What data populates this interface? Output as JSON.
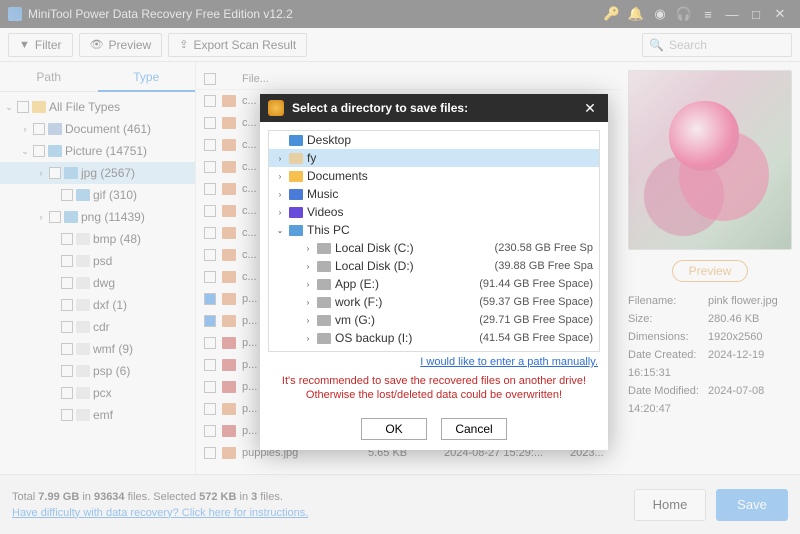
{
  "titlebar": {
    "title": "MiniTool Power Data Recovery Free Edition v12.2"
  },
  "toolbar": {
    "filter": "Filter",
    "preview": "Preview",
    "export": "Export Scan Result",
    "search_placeholder": "Search"
  },
  "tabs": {
    "path": "Path",
    "type": "Type"
  },
  "tree": {
    "all": "All File Types",
    "document": "Document (461)",
    "picture": "Picture (14751)",
    "jpg": "jpg (2567)",
    "gif": "gif (310)",
    "png": "png (11439)",
    "bmp": "bmp (48)",
    "psd": "psd",
    "dwg": "dwg",
    "dxf": "dxf (1)",
    "cdr": "cdr",
    "wmf": "wmf (9)",
    "psp": "psp (6)",
    "pcx": "pcx",
    "emf": "emf"
  },
  "filelist": {
    "header": "File...",
    "rows": [
      {
        "name": "c...",
        "checked": false,
        "bad": false
      },
      {
        "name": "c...",
        "checked": false,
        "bad": false
      },
      {
        "name": "c...",
        "checked": false,
        "bad": false
      },
      {
        "name": "c...",
        "checked": false,
        "bad": false
      },
      {
        "name": "c...",
        "checked": false,
        "bad": false
      },
      {
        "name": "c...",
        "checked": false,
        "bad": false
      },
      {
        "name": "c...",
        "checked": false,
        "bad": false
      },
      {
        "name": "c...",
        "checked": false,
        "bad": false
      },
      {
        "name": "c...",
        "checked": false,
        "bad": false
      },
      {
        "name": "p...",
        "checked": true,
        "bad": false
      },
      {
        "name": "p...",
        "checked": true,
        "bad": false
      },
      {
        "name": "p...",
        "checked": false,
        "bad": true
      },
      {
        "name": "p...",
        "checked": false,
        "bad": true
      },
      {
        "name": "p...",
        "checked": false,
        "bad": true
      },
      {
        "name": "p...",
        "checked": false,
        "bad": false
      },
      {
        "name": "p...",
        "checked": false,
        "bad": true
      }
    ],
    "last": {
      "name": "puppies.jpg",
      "size": "5.65 KB",
      "date": "2024-08-27 15:29:...",
      "year": "2023..."
    }
  },
  "preview": {
    "button": "Preview",
    "fields": {
      "filename_k": "Filename:",
      "filename_v": "pink flower.jpg",
      "size_k": "Size:",
      "size_v": "280.46 KB",
      "dim_k": "Dimensions:",
      "dim_v": "1920x2560",
      "created_k": "Date Created:",
      "created_v": "2024-12-19 16:15:31",
      "modified_k": "Date Modified:",
      "modified_v": "2024-07-08 14:20:47"
    }
  },
  "bottom": {
    "line1_a": "Total ",
    "line1_b": "7.99 GB",
    "line1_c": " in ",
    "line1_d": "93634",
    "line1_e": " files.   Selected ",
    "line1_f": "572 KB",
    "line1_g": " in ",
    "line1_h": "3",
    "line1_i": " files.",
    "help": "Have difficulty with data recovery? Click here for instructions.",
    "home": "Home",
    "save": "Save"
  },
  "modal": {
    "title": "Select a directory to save files:",
    "items": {
      "desktop": "Desktop",
      "fy": "fy",
      "documents": "Documents",
      "music": "Music",
      "videos": "Videos",
      "thispc": "This PC"
    },
    "drives": [
      {
        "name": "Local Disk (C:)",
        "free": "(230.58 GB Free Sp"
      },
      {
        "name": "Local Disk (D:)",
        "free": "(39.88 GB Free Spa"
      },
      {
        "name": "App (E:)",
        "free": "(91.44 GB Free Space)"
      },
      {
        "name": "work (F:)",
        "free": "(59.37 GB Free Space)"
      },
      {
        "name": "vm (G:)",
        "free": "(29.71 GB Free Space)"
      },
      {
        "name": "OS backup (I:)",
        "free": "(41.54 GB Free Space)"
      }
    ],
    "manual": "I would like to enter a path manually.",
    "warn": "It's recommended to save the recovered files on another drive! Otherwise the lost/deleted data could be overwritten!",
    "ok": "OK",
    "cancel": "Cancel"
  }
}
